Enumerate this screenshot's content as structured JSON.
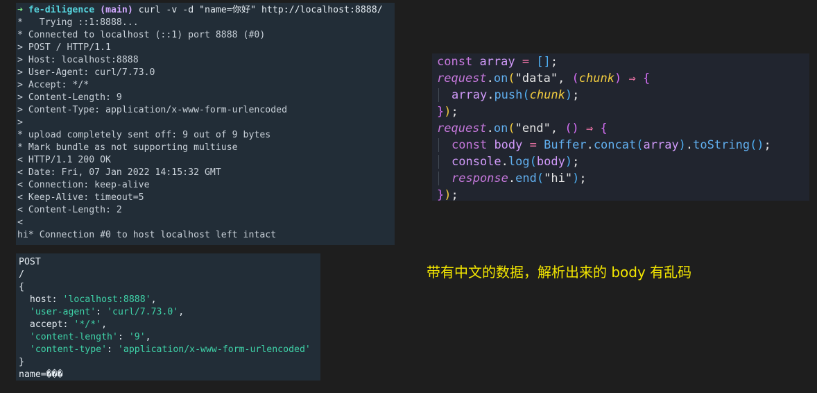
{
  "terminal": {
    "prompt_arrow": "➜",
    "prompt_dir": "fe-diligence",
    "prompt_branch": "(main)",
    "command": "curl -v -d \"name=你好\" http://localhost:8888/",
    "lines": [
      "*   Trying ::1:8888...",
      "* Connected to localhost (::1) port 8888 (#0)",
      "> POST / HTTP/1.1",
      "> Host: localhost:8888",
      "> User-Agent: curl/7.73.0",
      "> Accept: */*",
      "> Content-Length: 9",
      "> Content-Type: application/x-www-form-urlencoded",
      ">",
      "* upload completely sent off: 9 out of 9 bytes",
      "* Mark bundle as not supporting multiuse",
      "< HTTP/1.1 200 OK",
      "< Date: Fri, 07 Jan 2022 14:15:32 GMT",
      "< Connection: keep-alive",
      "< Keep-Alive: timeout=5",
      "< Content-Length: 2",
      "<",
      "hi* Connection #0 to host localhost left intact"
    ]
  },
  "server_log": {
    "method": "POST",
    "path": "/",
    "open_brace": "{",
    "headers": [
      {
        "key": "host",
        "value": "'localhost:8888'"
      },
      {
        "key": "'user-agent'",
        "value": "'curl/7.73.0'"
      },
      {
        "key": "accept",
        "value": "'*/*'"
      },
      {
        "key": "'content-length'",
        "value": "'9'"
      },
      {
        "key": "'content-type'",
        "value": "'application/x-www-form-urlencoded'"
      }
    ],
    "close_brace": "}",
    "body_line": "name=���"
  },
  "code": {
    "const_kw": "const",
    "array_var": "array",
    "request_obj": "request",
    "on_fn": "on",
    "data_event": "\"data\"",
    "chunk_param": "chunk",
    "push_fn": "push",
    "end_event": "\"end\"",
    "body_var": "body",
    "buffer_cls": "Buffer",
    "concat_fn": "concat",
    "tostring_fn": "toString",
    "console_obj": "console",
    "log_fn": "log",
    "response_obj": "response",
    "end_fn": "end",
    "hi_str": "\"hi\"",
    "arrow": "⇒"
  },
  "annotation": "带有中文的数据，解析出来的 body 有乱码"
}
